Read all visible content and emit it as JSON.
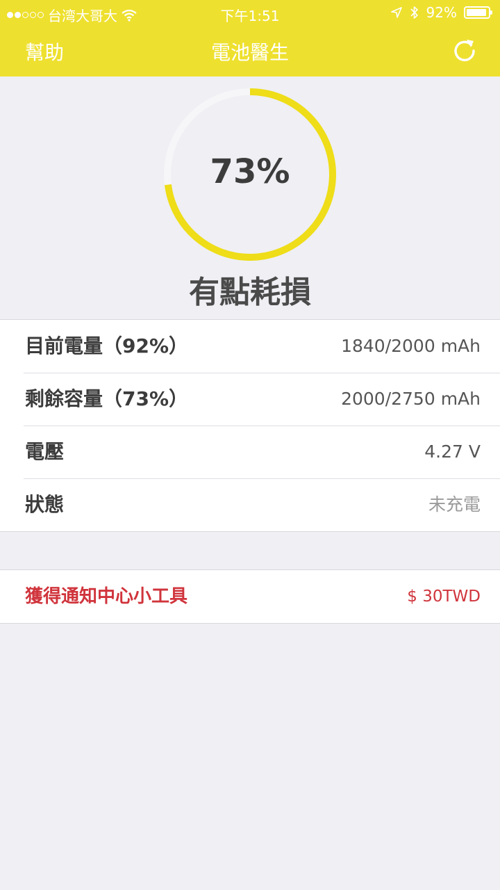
{
  "status_bar": {
    "carrier": "台湾大哥大",
    "time": "下午1:51",
    "battery_text": "92%",
    "battery_level": 0.92
  },
  "nav": {
    "help_label": "幫助",
    "title": "電池醫生",
    "refresh_icon": "refresh-icon"
  },
  "gauge": {
    "value_text": "73%",
    "fraction": 0.73,
    "condition": "有點耗損"
  },
  "details": [
    {
      "label": "目前電量（92%）",
      "value": "1840/2000 mAh"
    },
    {
      "label": "剩餘容量（73%）",
      "value": "2000/2750 mAh"
    },
    {
      "label": "電壓",
      "value": "4.27 V"
    },
    {
      "label": "狀態",
      "value": "未充電"
    }
  ],
  "promo": {
    "label": "獲得通知中心小工具",
    "price": "$ 30TWD"
  },
  "colors": {
    "accent": "#eee02e",
    "gauge_fill": "#eedd18",
    "gauge_track": "#f6f6f8",
    "promo_red": "#d0343c"
  }
}
